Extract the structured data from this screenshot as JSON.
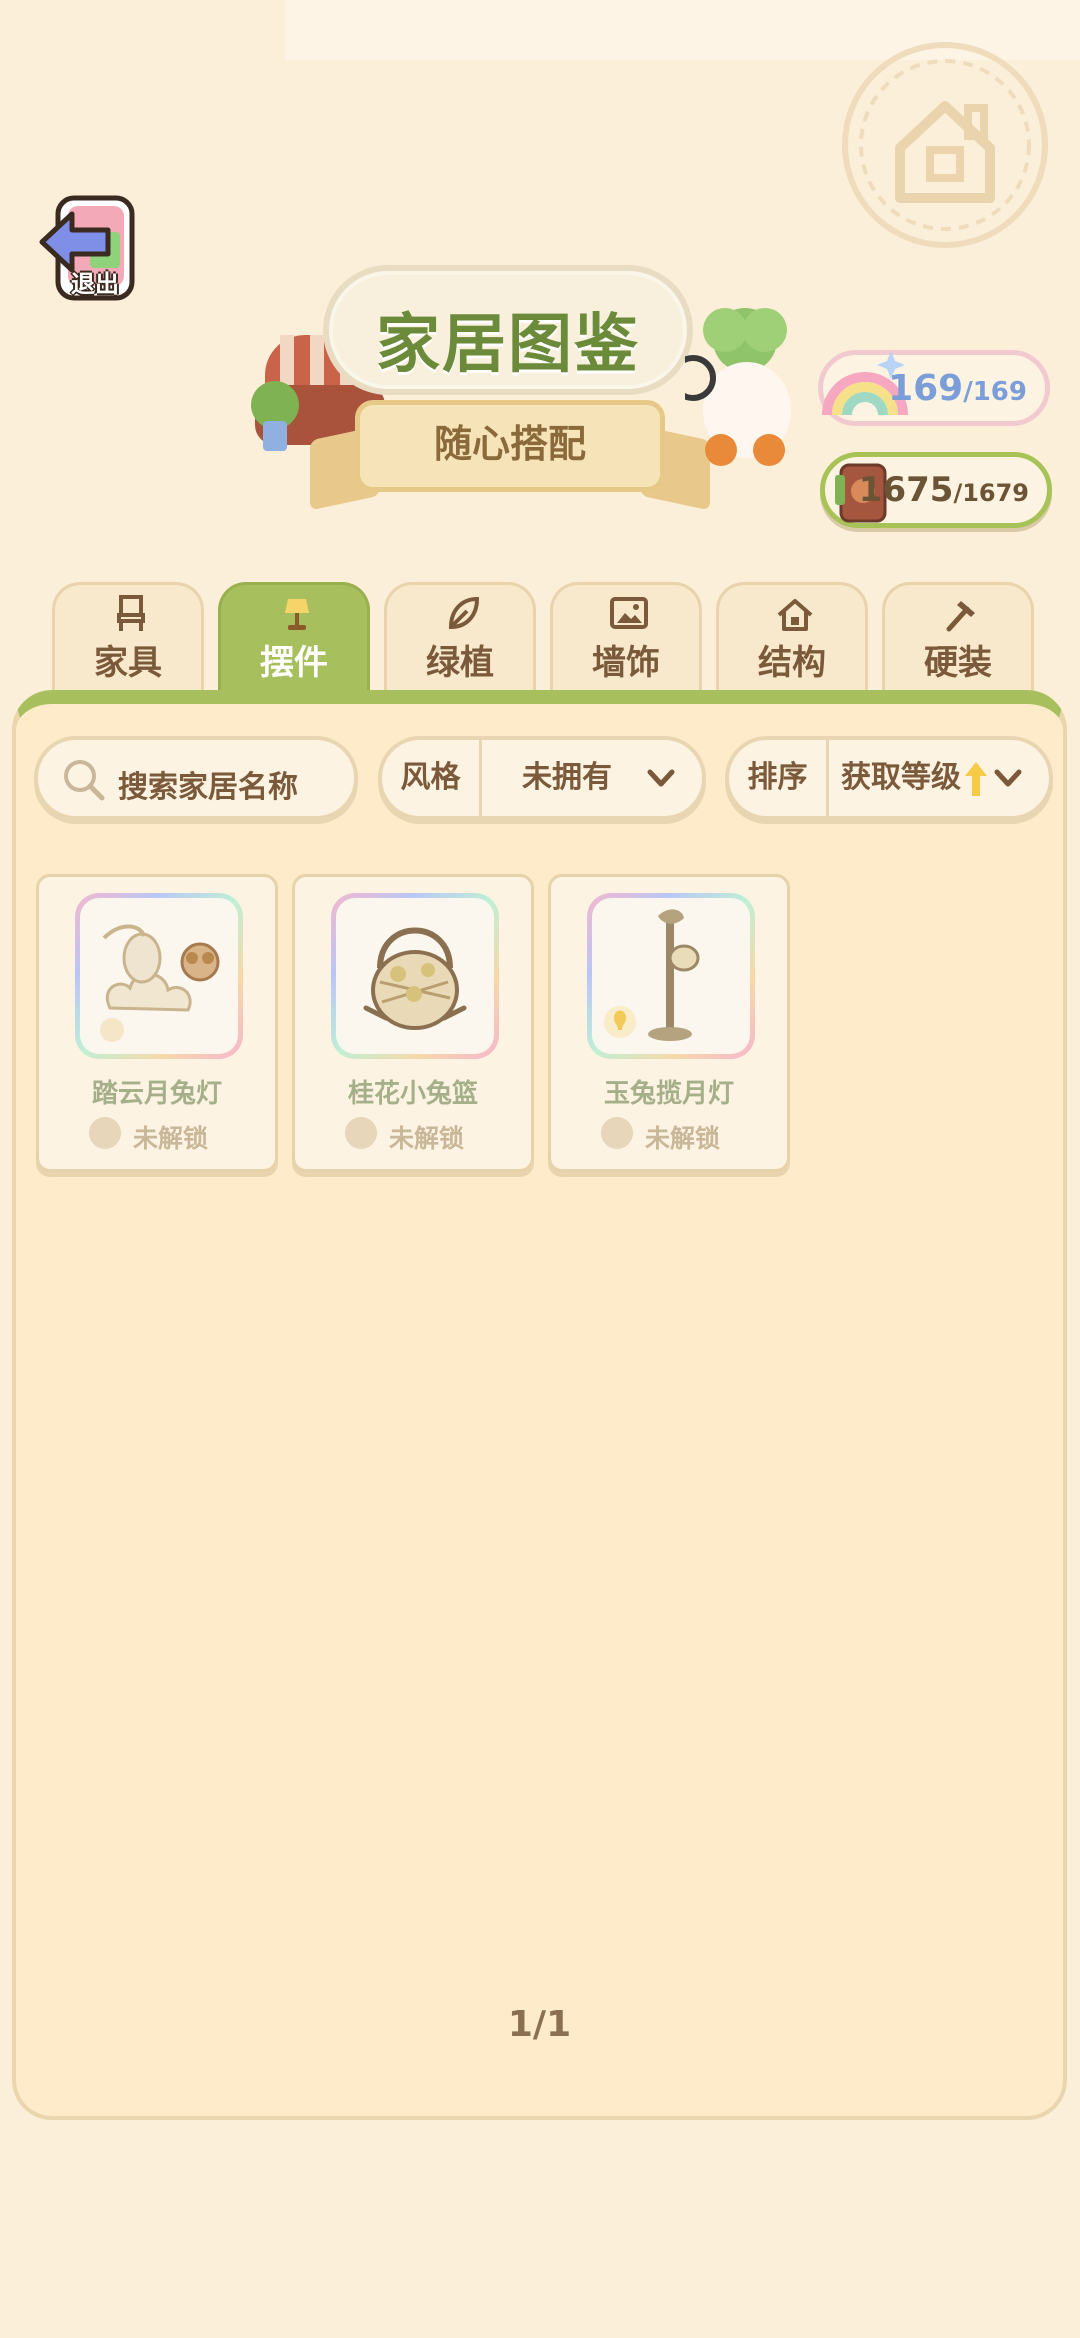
{
  "exit": {
    "label": "退出"
  },
  "header": {
    "title": "家居图鉴",
    "subtitle": "随心搭配"
  },
  "counters": [
    {
      "value": "169",
      "total": "/169"
    },
    {
      "value": "1675",
      "total": "/1679"
    }
  ],
  "tabs": [
    {
      "label": "家具",
      "icon": "chair-icon"
    },
    {
      "label": "摆件",
      "icon": "lamp-icon",
      "active": true
    },
    {
      "label": "绿植",
      "icon": "leaf-icon"
    },
    {
      "label": "墙饰",
      "icon": "picture-icon"
    },
    {
      "label": "结构",
      "icon": "house-icon"
    },
    {
      "label": "硬装",
      "icon": "hammer-icon"
    }
  ],
  "search": {
    "placeholder": "搜索家居名称"
  },
  "filter": {
    "label": "风格",
    "value": "未拥有"
  },
  "sort": {
    "label": "排序",
    "value": "获取等级"
  },
  "items": [
    {
      "name": "踏云月兔灯",
      "status": "未解锁"
    },
    {
      "name": "桂花小兔篮",
      "status": "未解锁"
    },
    {
      "name": "玉兔揽月灯",
      "status": "未解锁"
    }
  ],
  "pagination": {
    "text": "1/1"
  },
  "colors": {
    "accent_green": "#a8bf5e",
    "background": "#fbefd9",
    "title_green": "#6b8a3a",
    "counter_blue": "#7b9ed9"
  }
}
